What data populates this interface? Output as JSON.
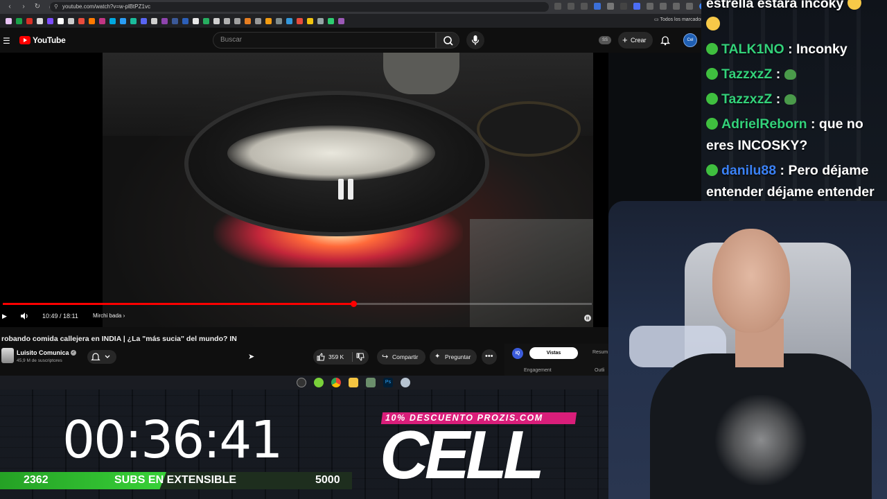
{
  "browser": {
    "url": "youtube.com/watch?v=w-plBtPZ1vc",
    "bookmarks_folder": "Todos los marcadores"
  },
  "youtube": {
    "logo_text": "YouTube",
    "search_placeholder": "Buscar",
    "ss_badge": "SS",
    "create_label": "Crear",
    "avatar_text": "Cel"
  },
  "player": {
    "current_time": "10:49",
    "duration": "18:11",
    "time_display": "10:49 / 18:11",
    "chapter": "Mirchi bada",
    "progress_fraction": 0.595
  },
  "video": {
    "title": "robando comida callejera en INDIA | ¿La \"más sucia\" del mundo? IN",
    "channel_name": "Luisito Comunica",
    "subscribers": "45,9 M de suscriptores",
    "likes": "359 K",
    "share_label": "Compartir",
    "ask_label": "Preguntar"
  },
  "analytics_panel": {
    "badge": "IQ",
    "tab_active": "Vistas",
    "tab_other": "Resum",
    "engagement_label": "Engagement",
    "outline_label": "Outli"
  },
  "overlay": {
    "timer": "00:36:41",
    "subs_current": "2362",
    "subs_label": "SUBS EN EXTENSIBLE",
    "subs_goal": "5000",
    "subs_fraction": 0.4724,
    "promo": "10% DESCUENTO PROZIS.COM",
    "brand": "CELL"
  },
  "chat": {
    "messages": [
      {
        "user": "",
        "text": "estrella estara incoky"
      },
      {
        "user": "TALK1NO",
        "text": ": Inconky"
      },
      {
        "user": "TazzxzZ",
        "text": ":"
      },
      {
        "user": "TazzxzZ",
        "text": ":"
      },
      {
        "user": "AdrielReborn",
        "text": ": que no"
      },
      {
        "user": "",
        "text": "eres INCOSKY?"
      },
      {
        "user": "danilu88",
        "text": ": Pero déjame"
      },
      {
        "user": "",
        "text": "entender déjame entender"
      }
    ]
  },
  "colors": {
    "youtube_red": "#ff0000",
    "chat_username": "#33d17a",
    "chat_username_blue": "#3b82f6",
    "progress_bar": "#25a125",
    "promo": "#d91e7a"
  }
}
